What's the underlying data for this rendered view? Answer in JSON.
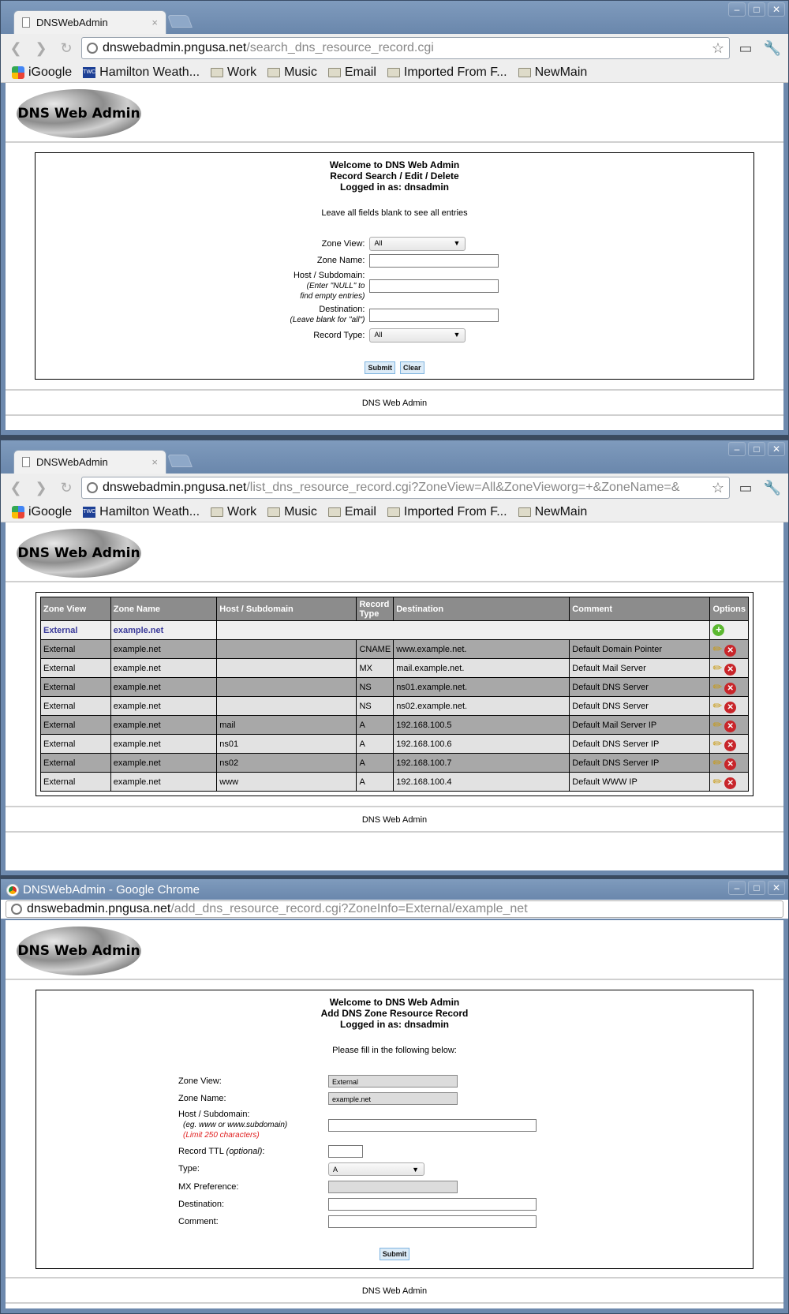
{
  "windows": [
    {
      "tab_title": "DNSWebAdmin",
      "url_host": "dnswebadmin.pngusa.net",
      "url_path": "/search_dns_resource_record.cgi"
    },
    {
      "tab_title": "DNSWebAdmin",
      "url_host": "dnswebadmin.pngusa.net",
      "url_path": "/list_dns_resource_record.cgi?ZoneView=All&ZoneVieworg=+&ZoneName=&"
    },
    {
      "window_title": "DNSWebAdmin - Google Chrome",
      "url_host": "dnswebadmin.pngusa.net",
      "url_path": "/add_dns_resource_record.cgi?ZoneInfo=External/example_net"
    }
  ],
  "bookmarks": [
    "iGoogle",
    "Hamilton Weath...",
    "Work",
    "Music",
    "Email",
    "Imported From F...",
    "NewMain"
  ],
  "logo_text": "DNS Web Admin",
  "footer_text": "DNS Web Admin",
  "search_page": {
    "header": [
      "Welcome to DNS Web Admin",
      "Record Search / Edit / Delete",
      "Logged in as: dnsadmin"
    ],
    "note": "Leave all fields blank to see all entries",
    "zone_view_label": "Zone View:",
    "zone_view_value": "All",
    "zone_name_label": "Zone Name:",
    "host_label": "Host / Subdomain:",
    "host_hint_1": "(Enter \"NULL\" to",
    "host_hint_2": "find empty entries)",
    "destination_label": "Destination:",
    "destination_hint": "(Leave blank for \"all\")",
    "record_type_label": "Record Type:",
    "record_type_value": "All",
    "submit_label": "Submit",
    "clear_label": "Clear"
  },
  "list_page": {
    "columns": [
      "Zone View",
      "Zone Name",
      "Host / Subdomain",
      "Record Type",
      "Destination",
      "Comment",
      "Options"
    ],
    "zone_row": {
      "zone_view": "External",
      "zone_name": "example.net"
    },
    "rows": [
      {
        "zone_view": "External",
        "zone_name": "example.net",
        "host": "",
        "type": "CNAME",
        "destination": "www.example.net.",
        "comment": "Default Domain Pointer"
      },
      {
        "zone_view": "External",
        "zone_name": "example.net",
        "host": "",
        "type": "MX",
        "destination": "mail.example.net.",
        "comment": "Default Mail Server"
      },
      {
        "zone_view": "External",
        "zone_name": "example.net",
        "host": "",
        "type": "NS",
        "destination": "ns01.example.net.",
        "comment": "Default DNS Server"
      },
      {
        "zone_view": "External",
        "zone_name": "example.net",
        "host": "",
        "type": "NS",
        "destination": "ns02.example.net.",
        "comment": "Default DNS Server"
      },
      {
        "zone_view": "External",
        "zone_name": "example.net",
        "host": "mail",
        "type": "A",
        "destination": "192.168.100.5",
        "comment": "Default Mail Server IP"
      },
      {
        "zone_view": "External",
        "zone_name": "example.net",
        "host": "ns01",
        "type": "A",
        "destination": "192.168.100.6",
        "comment": "Default DNS Server IP"
      },
      {
        "zone_view": "External",
        "zone_name": "example.net",
        "host": "ns02",
        "type": "A",
        "destination": "192.168.100.7",
        "comment": "Default DNS Server IP"
      },
      {
        "zone_view": "External",
        "zone_name": "example.net",
        "host": "www",
        "type": "A",
        "destination": "192.168.100.4",
        "comment": "Default WWW IP"
      }
    ]
  },
  "add_page": {
    "header": [
      "Welcome to DNS Web Admin",
      "Add DNS Zone Resource Record",
      "Logged in as: dnsadmin"
    ],
    "note": "Please fill in the following below:",
    "zone_view_label": "Zone View:",
    "zone_view_value": "External",
    "zone_name_label": "Zone Name:",
    "zone_name_value": "example.net",
    "host_label": "Host / Subdomain:",
    "host_hint": "(eg. www or www.subdomain)",
    "host_limit": "(Limit 250 characters)",
    "ttl_label": "Record TTL",
    "ttl_optional": "(optional)",
    "ttl_colon": ":",
    "type_label": "Type:",
    "type_value": "A",
    "mx_label": "MX Preference:",
    "destination_label": "Destination:",
    "comment_label": "Comment:",
    "submit_label": "Submit"
  }
}
